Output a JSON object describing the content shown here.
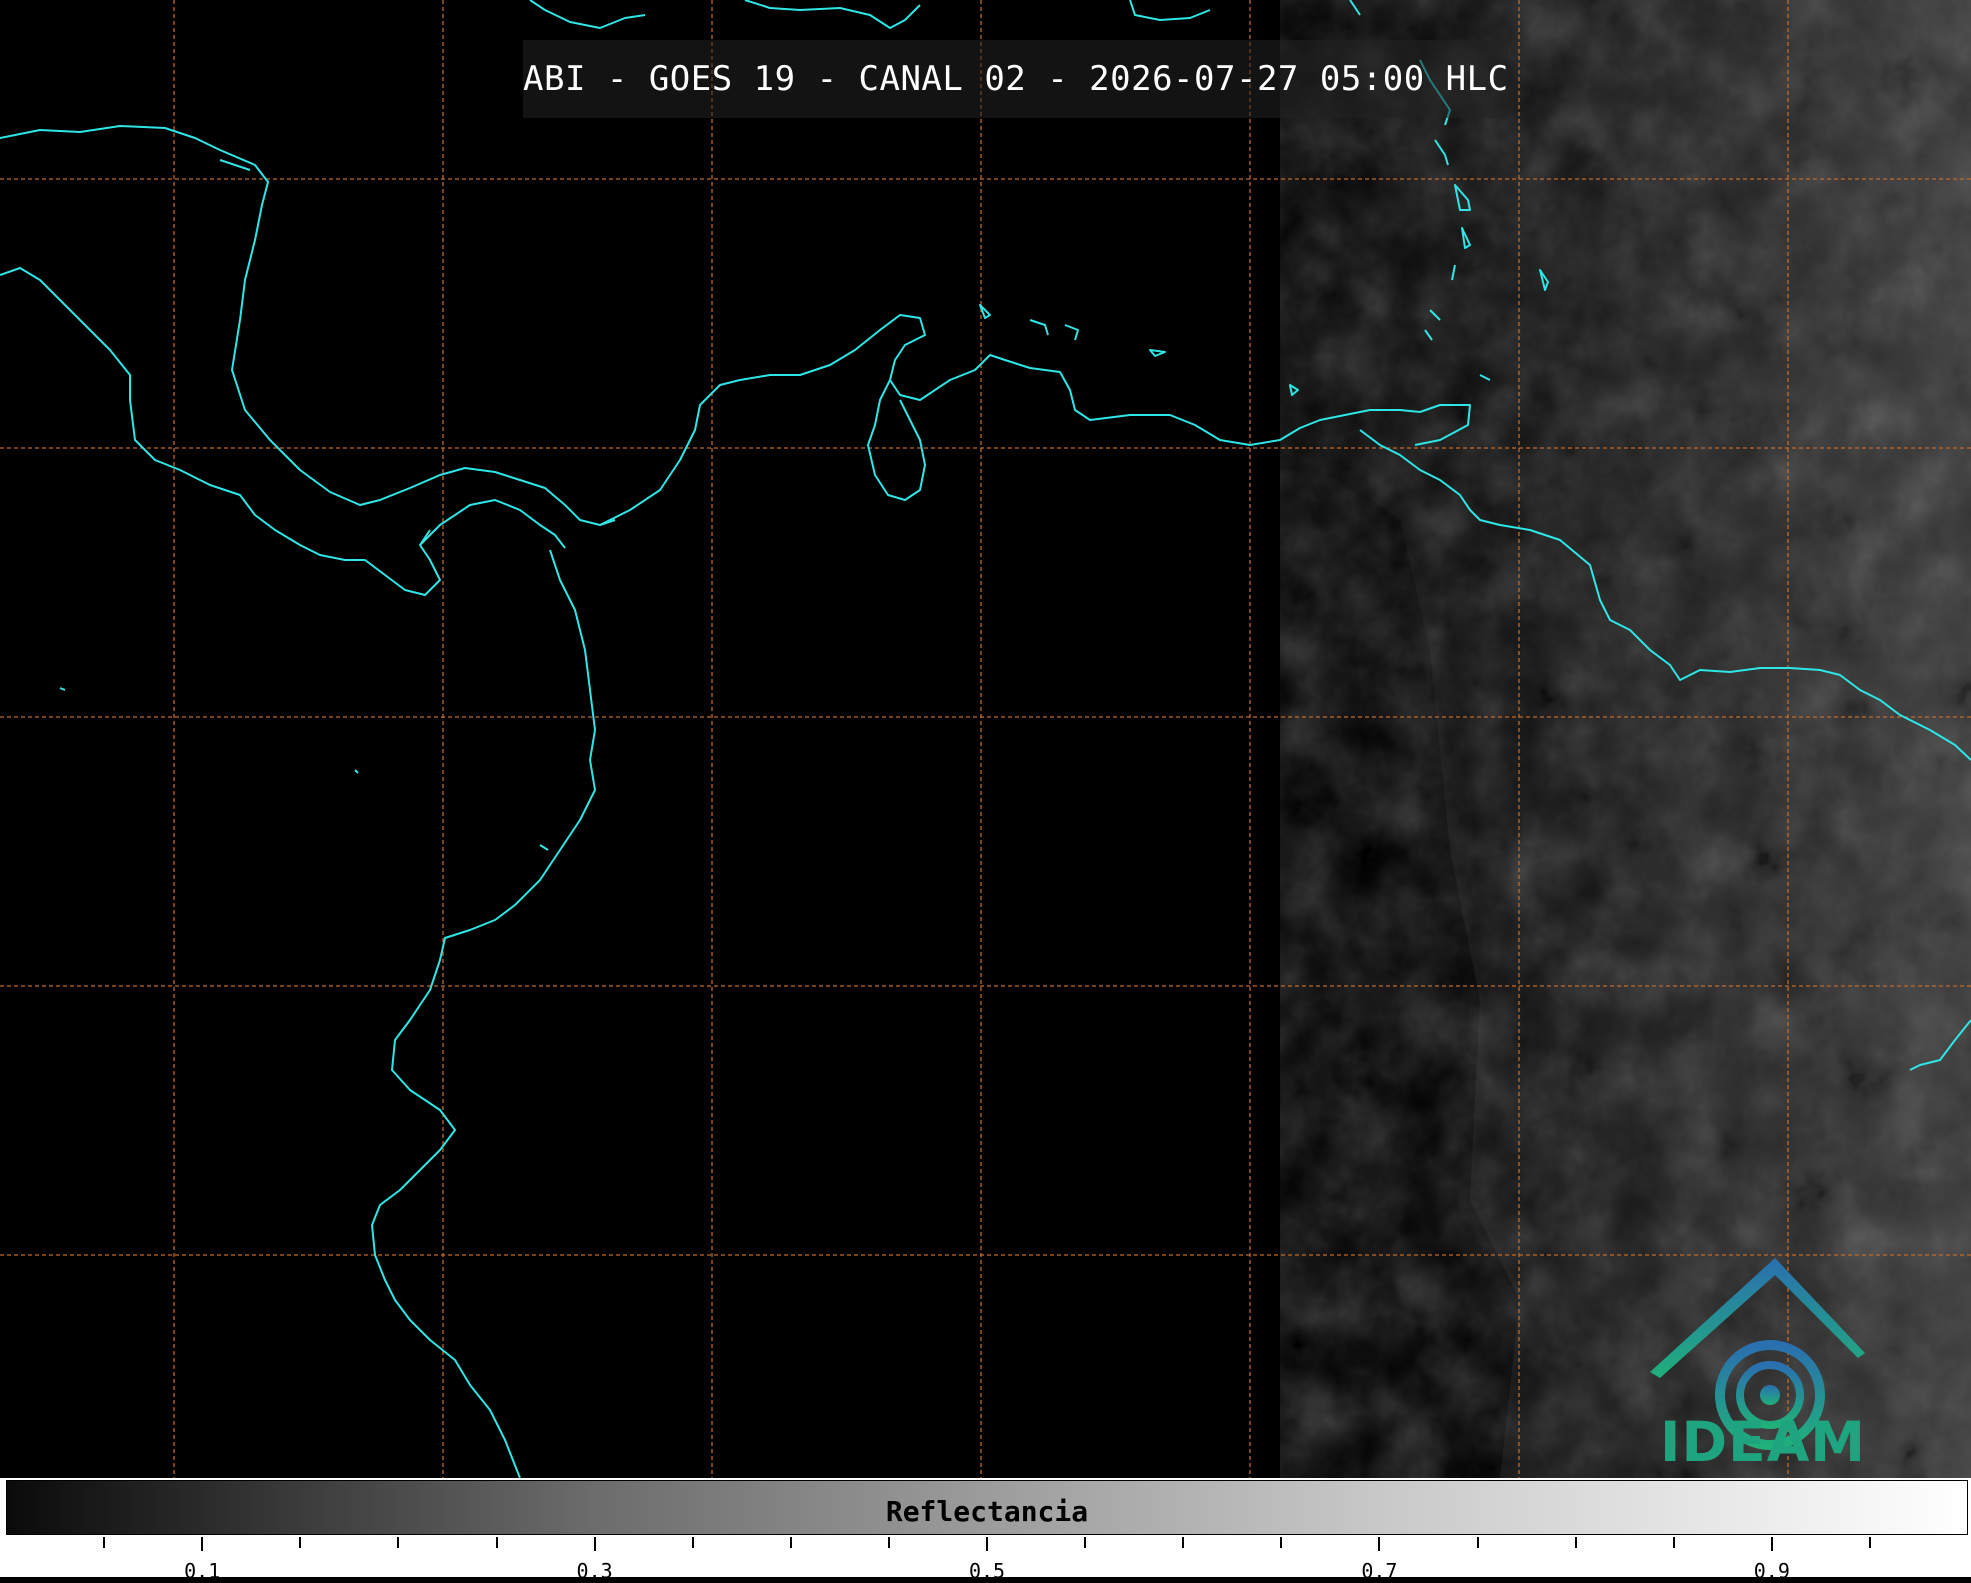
{
  "title": "ABI - GOES 19 - CANAL 02 - 2026-07-27 05:00 HLC",
  "colorbar": {
    "label": "Reflectancia",
    "major_ticks": [
      {
        "value": 0.1,
        "label": "0.1"
      },
      {
        "value": 0.3,
        "label": "0.3"
      },
      {
        "value": 0.5,
        "label": "0.5"
      },
      {
        "value": 0.7,
        "label": "0.7"
      },
      {
        "value": 0.9,
        "label": "0.9"
      }
    ],
    "minor_tick_step": 0.05,
    "range": [
      0.0,
      1.0
    ]
  },
  "logo": {
    "text": "IDEAM",
    "icon": "ideam-roof-spiral-icon"
  },
  "colors": {
    "coastline": "#2ee6e6",
    "gridline": "#c06a2a",
    "logo_gradient_top": "#2a6fb0",
    "logo_gradient_bottom": "#20b07a",
    "background": "#000000"
  },
  "map": {
    "gridlines": "dashed orange lat/lon graticule",
    "imagery": "grayscale visible reflectance, cloud texture on east side"
  }
}
